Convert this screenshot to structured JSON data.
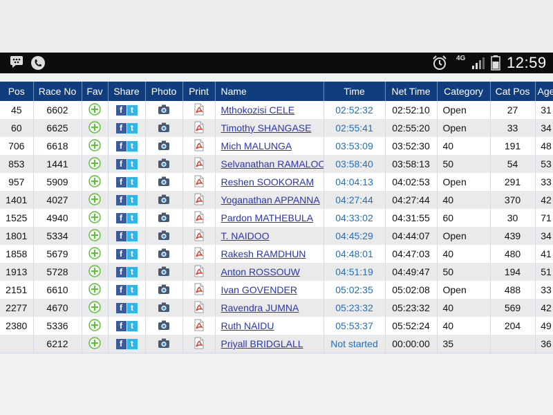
{
  "status": {
    "time": "12:59",
    "network": "4G"
  },
  "headers": {
    "pos": "Pos",
    "race_no": "Race No",
    "fav": "Fav",
    "share": "Share",
    "photo": "Photo",
    "print": "Print",
    "name": "Name",
    "time": "Time",
    "net_time": "Net Time",
    "category": "Category",
    "cat_pos": "Cat Pos",
    "age": "Age"
  },
  "rows": [
    {
      "pos": "45",
      "race_no": "6602",
      "name": "Mthokozisi CELE",
      "time": "02:52:32",
      "net_time": "02:52:10",
      "category": "Open",
      "cat_pos": "27",
      "age": "31"
    },
    {
      "pos": "60",
      "race_no": "6625",
      "name": "Timothy SHANGASE",
      "time": "02:55:41",
      "net_time": "02:55:20",
      "category": "Open",
      "cat_pos": "33",
      "age": "34"
    },
    {
      "pos": "706",
      "race_no": "6618",
      "name": "Mich MALUNGA",
      "time": "03:53:09",
      "net_time": "03:52:30",
      "category": "40",
      "cat_pos": "191",
      "age": "48"
    },
    {
      "pos": "853",
      "race_no": "1441",
      "name": "Selvanathan RAMALOO",
      "time": "03:58:40",
      "net_time": "03:58:13",
      "category": "50",
      "cat_pos": "54",
      "age": "53"
    },
    {
      "pos": "957",
      "race_no": "5909",
      "name": "Reshen SOOKORAM",
      "time": "04:04:13",
      "net_time": "04:02:53",
      "category": "Open",
      "cat_pos": "291",
      "age": "33"
    },
    {
      "pos": "1401",
      "race_no": "4027",
      "name": "Yoganathan APPANNA",
      "time": "04:27:44",
      "net_time": "04:27:44",
      "category": "40",
      "cat_pos": "370",
      "age": "42"
    },
    {
      "pos": "1525",
      "race_no": "4940",
      "name": "Pardon MATHEBULA",
      "time": "04:33:02",
      "net_time": "04:31:55",
      "category": "60",
      "cat_pos": "30",
      "age": "71"
    },
    {
      "pos": "1801",
      "race_no": "5334",
      "name": "T. NAIDOO",
      "time": "04:45:29",
      "net_time": "04:44:07",
      "category": "Open",
      "cat_pos": "439",
      "age": "34"
    },
    {
      "pos": "1858",
      "race_no": "5679",
      "name": "Rakesh RAMDHUN",
      "time": "04:48:01",
      "net_time": "04:47:03",
      "category": "40",
      "cat_pos": "480",
      "age": "41"
    },
    {
      "pos": "1913",
      "race_no": "5728",
      "name": "Anton ROSSOUW",
      "time": "04:51:19",
      "net_time": "04:49:47",
      "category": "50",
      "cat_pos": "194",
      "age": "51"
    },
    {
      "pos": "2151",
      "race_no": "6610",
      "name": "Ivan GOVENDER",
      "time": "05:02:35",
      "net_time": "05:02:08",
      "category": "Open",
      "cat_pos": "488",
      "age": "33"
    },
    {
      "pos": "2277",
      "race_no": "4670",
      "name": "Ravendra JUMNA",
      "time": "05:23:32",
      "net_time": "05:23:32",
      "category": "40",
      "cat_pos": "569",
      "age": "42"
    },
    {
      "pos": "2380",
      "race_no": "5336",
      "name": "Ruth NAIDU",
      "time": "05:53:37",
      "net_time": "05:52:24",
      "category": "40",
      "cat_pos": "204",
      "age": "49"
    },
    {
      "pos": "",
      "race_no": "6212",
      "name": "Priyall BRIDGLALL",
      "time": "Not started",
      "net_time": "00:00:00",
      "category": "35",
      "cat_pos": "",
      "age": "36"
    }
  ],
  "icons": {
    "fav": "plus-circle-icon",
    "facebook": "facebook-icon",
    "twitter": "twitter-icon",
    "photo": "camera-icon",
    "print": "pdf-icon"
  },
  "colors": {
    "header_bg": "#0f3d7d",
    "link": "#2b34b8",
    "time": "#1d6fc2",
    "fav": "#5fbf3a",
    "pdf": "#d23a2a"
  }
}
